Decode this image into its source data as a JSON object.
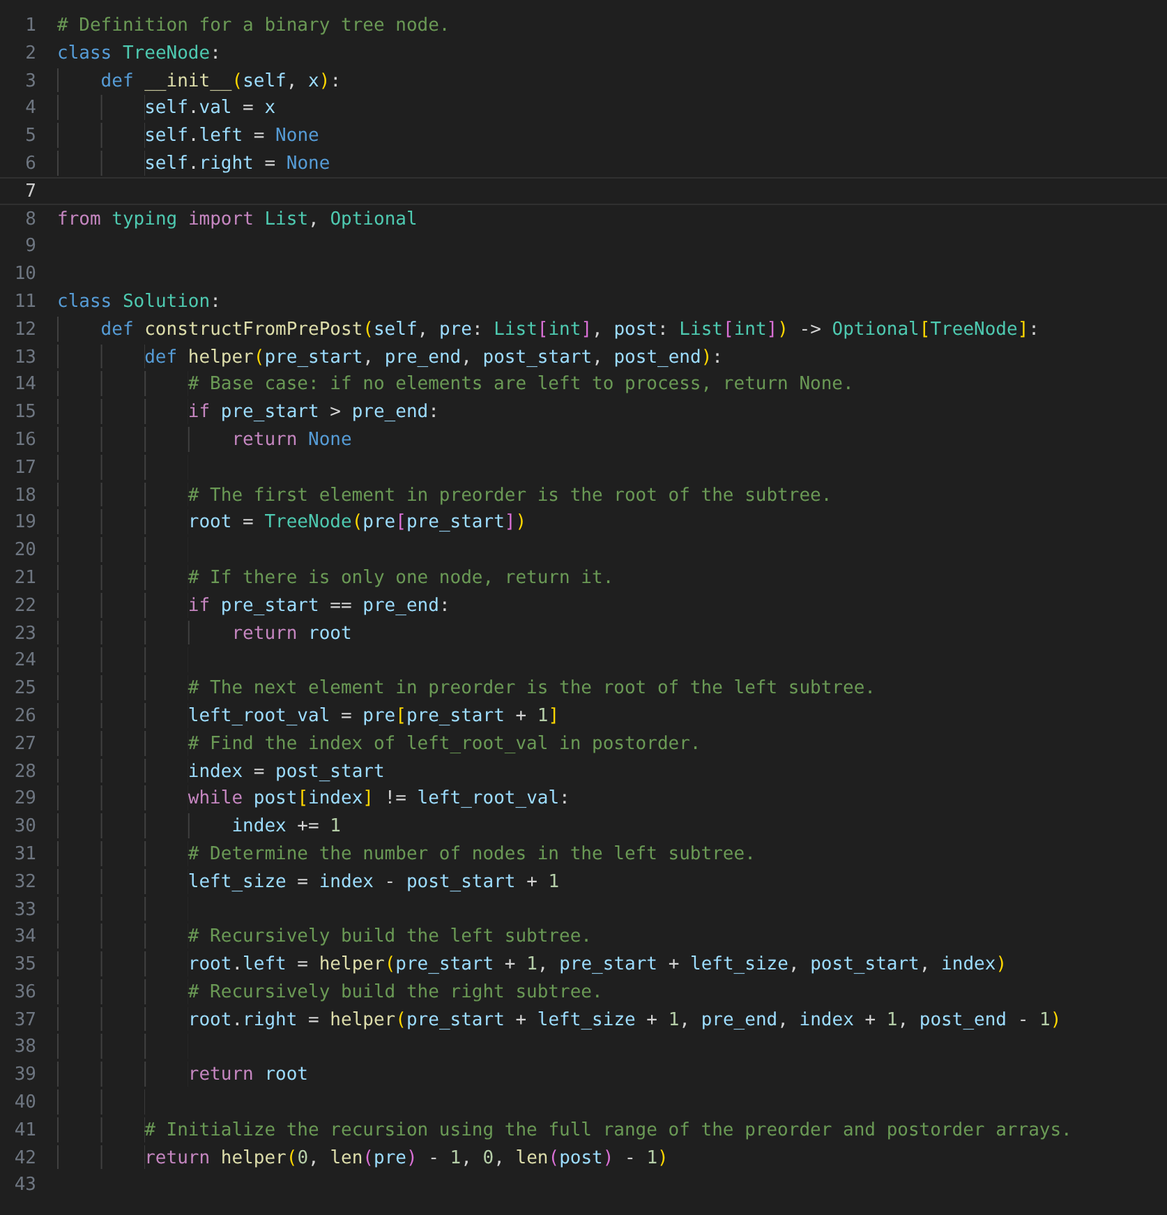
{
  "editor": {
    "lines": [
      {
        "number": "1",
        "current": false,
        "tokens": [
          {
            "text": "# Definition for a binary tree node.",
            "kind": "comment"
          }
        ]
      },
      {
        "number": "2",
        "current": false,
        "tokens": [
          {
            "text": "class ",
            "kind": "keyword"
          },
          {
            "text": "TreeNode",
            "kind": "class"
          },
          {
            "text": ":",
            "kind": "op"
          }
        ],
        "children": [
          {
            "number": "3",
            "current": false,
            "tokens": [
              {
                "text": "def ",
                "kind": "keyword"
              },
              {
                "text": "__init__",
                "kind": "function"
              },
              {
                "text": "(",
                "kind": "bracket1"
              },
              {
                "text": "self",
                "kind": "variable"
              },
              {
                "text": ", ",
                "kind": "op"
              },
              {
                "text": "x",
                "kind": "variable"
              },
              {
                "text": ")",
                "kind": "bracket1"
              },
              {
                "text": ":",
                "kind": "op"
              }
            ],
            "children": [
              {
                "number": "4",
                "current": false,
                "tokens": [
                  {
                    "text": "self",
                    "kind": "variable"
                  },
                  {
                    "text": ".",
                    "kind": "op"
                  },
                  {
                    "text": "val",
                    "kind": "variable"
                  },
                  {
                    "text": " = ",
                    "kind": "op"
                  },
                  {
                    "text": "x",
                    "kind": "variable"
                  }
                ]
              },
              {
                "number": "5",
                "current": false,
                "tokens": [
                  {
                    "text": "self",
                    "kind": "variable"
                  },
                  {
                    "text": ".",
                    "kind": "op"
                  },
                  {
                    "text": "left",
                    "kind": "variable"
                  },
                  {
                    "text": " = ",
                    "kind": "op"
                  },
                  {
                    "text": "None",
                    "kind": "constant"
                  }
                ]
              },
              {
                "number": "6",
                "current": false,
                "tokens": [
                  {
                    "text": "self",
                    "kind": "variable"
                  },
                  {
                    "text": ".",
                    "kind": "op"
                  },
                  {
                    "text": "right",
                    "kind": "variable"
                  },
                  {
                    "text": " = ",
                    "kind": "op"
                  },
                  {
                    "text": "None",
                    "kind": "constant"
                  }
                ]
              }
            ]
          }
        ]
      },
      {
        "number": "7",
        "current": true
      },
      {
        "number": "8",
        "current": false,
        "tokens": [
          {
            "text": "from ",
            "kind": "control"
          },
          {
            "text": "typing ",
            "kind": "class"
          },
          {
            "text": "import ",
            "kind": "control"
          },
          {
            "text": "List",
            "kind": "class"
          },
          {
            "text": ", ",
            "kind": "op"
          },
          {
            "text": "Optional",
            "kind": "class"
          }
        ]
      },
      {
        "number": "9",
        "current": false
      },
      {
        "number": "10",
        "current": false
      },
      {
        "number": "11",
        "current": false,
        "tokens": [
          {
            "text": "class ",
            "kind": "keyword"
          },
          {
            "text": "Solution",
            "kind": "class"
          },
          {
            "text": ":",
            "kind": "op"
          }
        ],
        "children": [
          {
            "number": "12",
            "current": false,
            "tokens": [
              {
                "text": "def ",
                "kind": "keyword"
              },
              {
                "text": "constructFromPrePost",
                "kind": "function"
              },
              {
                "text": "(",
                "kind": "bracket1"
              },
              {
                "text": "self",
                "kind": "variable"
              },
              {
                "text": ", ",
                "kind": "op"
              },
              {
                "text": "pre",
                "kind": "variable"
              },
              {
                "text": ": ",
                "kind": "op"
              },
              {
                "text": "List",
                "kind": "class"
              },
              {
                "text": "[",
                "kind": "bracket2"
              },
              {
                "text": "int",
                "kind": "class"
              },
              {
                "text": "]",
                "kind": "bracket2"
              },
              {
                "text": ", ",
                "kind": "op"
              },
              {
                "text": "post",
                "kind": "variable"
              },
              {
                "text": ": ",
                "kind": "op"
              },
              {
                "text": "List",
                "kind": "class"
              },
              {
                "text": "[",
                "kind": "bracket2"
              },
              {
                "text": "int",
                "kind": "class"
              },
              {
                "text": "]",
                "kind": "bracket2"
              },
              {
                "text": ")",
                "kind": "bracket1"
              },
              {
                "text": " -> ",
                "kind": "op"
              },
              {
                "text": "Optional",
                "kind": "class"
              },
              {
                "text": "[",
                "kind": "bracket1"
              },
              {
                "text": "TreeNode",
                "kind": "class"
              },
              {
                "text": "]",
                "kind": "bracket1"
              },
              {
                "text": ":",
                "kind": "op"
              }
            ],
            "children": [
              {
                "number": "13",
                "current": false,
                "tokens": [
                  {
                    "text": "def ",
                    "kind": "keyword"
                  },
                  {
                    "text": "helper",
                    "kind": "function"
                  },
                  {
                    "text": "(",
                    "kind": "bracket1"
                  },
                  {
                    "text": "pre_start",
                    "kind": "variable"
                  },
                  {
                    "text": ", ",
                    "kind": "op"
                  },
                  {
                    "text": "pre_end",
                    "kind": "variable"
                  },
                  {
                    "text": ", ",
                    "kind": "op"
                  },
                  {
                    "text": "post_start",
                    "kind": "variable"
                  },
                  {
                    "text": ", ",
                    "kind": "op"
                  },
                  {
                    "text": "post_end",
                    "kind": "variable"
                  },
                  {
                    "text": ")",
                    "kind": "bracket1"
                  },
                  {
                    "text": ":",
                    "kind": "op"
                  }
                ],
                "children": [
                  {
                    "number": "14",
                    "current": false,
                    "tokens": [
                      {
                        "text": "# Base case: if no elements are left to process, return None.",
                        "kind": "comment"
                      }
                    ]
                  },
                  {
                    "number": "15",
                    "current": false,
                    "tokens": [
                      {
                        "text": "if ",
                        "kind": "control"
                      },
                      {
                        "text": "pre_start",
                        "kind": "variable"
                      },
                      {
                        "text": " > ",
                        "kind": "op"
                      },
                      {
                        "text": "pre_end",
                        "kind": "variable"
                      },
                      {
                        "text": ":",
                        "kind": "op"
                      }
                    ],
                    "children": [
                      {
                        "number": "16",
                        "current": false,
                        "tokens": [
                          {
                            "text": "return ",
                            "kind": "control"
                          },
                          {
                            "text": "None",
                            "kind": "constant"
                          }
                        ]
                      }
                    ]
                  },
                  {
                    "number": "17",
                    "current": false
                  },
                  {
                    "number": "18",
                    "current": false,
                    "tokens": [
                      {
                        "text": "# The first element in preorder is the root of the subtree.",
                        "kind": "comment"
                      }
                    ]
                  },
                  {
                    "number": "19",
                    "current": false,
                    "tokens": [
                      {
                        "text": "root",
                        "kind": "variable"
                      },
                      {
                        "text": " = ",
                        "kind": "op"
                      },
                      {
                        "text": "TreeNode",
                        "kind": "class"
                      },
                      {
                        "text": "(",
                        "kind": "bracket1"
                      },
                      {
                        "text": "pre",
                        "kind": "variable"
                      },
                      {
                        "text": "[",
                        "kind": "bracket2"
                      },
                      {
                        "text": "pre_start",
                        "kind": "variable"
                      },
                      {
                        "text": "]",
                        "kind": "bracket2"
                      },
                      {
                        "text": ")",
                        "kind": "bracket1"
                      }
                    ]
                  },
                  {
                    "number": "20",
                    "current": false
                  },
                  {
                    "number": "21",
                    "current": false,
                    "tokens": [
                      {
                        "text": "# If there is only one node, return it.",
                        "kind": "comment"
                      }
                    ]
                  },
                  {
                    "number": "22",
                    "current": false,
                    "tokens": [
                      {
                        "text": "if ",
                        "kind": "control"
                      },
                      {
                        "text": "pre_start",
                        "kind": "variable"
                      },
                      {
                        "text": " == ",
                        "kind": "op"
                      },
                      {
                        "text": "pre_end",
                        "kind": "variable"
                      },
                      {
                        "text": ":",
                        "kind": "op"
                      }
                    ],
                    "children": [
                      {
                        "number": "23",
                        "current": false,
                        "tokens": [
                          {
                            "text": "return ",
                            "kind": "control"
                          },
                          {
                            "text": "root",
                            "kind": "variable"
                          }
                        ]
                      }
                    ]
                  },
                  {
                    "number": "24",
                    "current": false
                  },
                  {
                    "number": "25",
                    "current": false,
                    "tokens": [
                      {
                        "text": "# The next element in preorder is the root of the left subtree.",
                        "kind": "comment"
                      }
                    ]
                  },
                  {
                    "number": "26",
                    "current": false,
                    "tokens": [
                      {
                        "text": "left_root_val",
                        "kind": "variable"
                      },
                      {
                        "text": " = ",
                        "kind": "op"
                      },
                      {
                        "text": "pre",
                        "kind": "variable"
                      },
                      {
                        "text": "[",
                        "kind": "bracket1"
                      },
                      {
                        "text": "pre_start",
                        "kind": "variable"
                      },
                      {
                        "text": " + ",
                        "kind": "op"
                      },
                      {
                        "text": "1",
                        "kind": "number"
                      },
                      {
                        "text": "]",
                        "kind": "bracket1"
                      }
                    ]
                  },
                  {
                    "number": "27",
                    "current": false,
                    "tokens": [
                      {
                        "text": "# Find the index of left_root_val in postorder.",
                        "kind": "comment"
                      }
                    ]
                  },
                  {
                    "number": "28",
                    "current": false,
                    "tokens": [
                      {
                        "text": "index",
                        "kind": "variable"
                      },
                      {
                        "text": " = ",
                        "kind": "op"
                      },
                      {
                        "text": "post_start",
                        "kind": "variable"
                      }
                    ]
                  },
                  {
                    "number": "29",
                    "current": false,
                    "tokens": [
                      {
                        "text": "while ",
                        "kind": "control"
                      },
                      {
                        "text": "post",
                        "kind": "variable"
                      },
                      {
                        "text": "[",
                        "kind": "bracket1"
                      },
                      {
                        "text": "index",
                        "kind": "variable"
                      },
                      {
                        "text": "]",
                        "kind": "bracket1"
                      },
                      {
                        "text": " != ",
                        "kind": "op"
                      },
                      {
                        "text": "left_root_val",
                        "kind": "variable"
                      },
                      {
                        "text": ":",
                        "kind": "op"
                      }
                    ],
                    "children": [
                      {
                        "number": "30",
                        "current": false,
                        "tokens": [
                          {
                            "text": "index",
                            "kind": "variable"
                          },
                          {
                            "text": " += ",
                            "kind": "op"
                          },
                          {
                            "text": "1",
                            "kind": "number"
                          }
                        ]
                      }
                    ]
                  },
                  {
                    "number": "31",
                    "current": false,
                    "tokens": [
                      {
                        "text": "# Determine the number of nodes in the left subtree.",
                        "kind": "comment"
                      }
                    ]
                  },
                  {
                    "number": "32",
                    "current": false,
                    "tokens": [
                      {
                        "text": "left_size",
                        "kind": "variable"
                      },
                      {
                        "text": " = ",
                        "kind": "op"
                      },
                      {
                        "text": "index",
                        "kind": "variable"
                      },
                      {
                        "text": " - ",
                        "kind": "op"
                      },
                      {
                        "text": "post_start",
                        "kind": "variable"
                      },
                      {
                        "text": " + ",
                        "kind": "op"
                      },
                      {
                        "text": "1",
                        "kind": "number"
                      }
                    ]
                  },
                  {
                    "number": "33",
                    "current": false
                  },
                  {
                    "number": "34",
                    "current": false,
                    "tokens": [
                      {
                        "text": "# Recursively build the left subtree.",
                        "kind": "comment"
                      }
                    ]
                  },
                  {
                    "number": "35",
                    "current": false,
                    "tokens": [
                      {
                        "text": "root",
                        "kind": "variable"
                      },
                      {
                        "text": ".",
                        "kind": "op"
                      },
                      {
                        "text": "left",
                        "kind": "variable"
                      },
                      {
                        "text": " = ",
                        "kind": "op"
                      },
                      {
                        "text": "helper",
                        "kind": "function"
                      },
                      {
                        "text": "(",
                        "kind": "bracket1"
                      },
                      {
                        "text": "pre_start",
                        "kind": "variable"
                      },
                      {
                        "text": " + ",
                        "kind": "op"
                      },
                      {
                        "text": "1",
                        "kind": "number"
                      },
                      {
                        "text": ", ",
                        "kind": "op"
                      },
                      {
                        "text": "pre_start",
                        "kind": "variable"
                      },
                      {
                        "text": " + ",
                        "kind": "op"
                      },
                      {
                        "text": "left_size",
                        "kind": "variable"
                      },
                      {
                        "text": ", ",
                        "kind": "op"
                      },
                      {
                        "text": "post_start",
                        "kind": "variable"
                      },
                      {
                        "text": ", ",
                        "kind": "op"
                      },
                      {
                        "text": "index",
                        "kind": "variable"
                      },
                      {
                        "text": ")",
                        "kind": "bracket1"
                      }
                    ]
                  },
                  {
                    "number": "36",
                    "current": false,
                    "tokens": [
                      {
                        "text": "# Recursively build the right subtree.",
                        "kind": "comment"
                      }
                    ]
                  },
                  {
                    "number": "37",
                    "current": false,
                    "tokens": [
                      {
                        "text": "root",
                        "kind": "variable"
                      },
                      {
                        "text": ".",
                        "kind": "op"
                      },
                      {
                        "text": "right",
                        "kind": "variable"
                      },
                      {
                        "text": " = ",
                        "kind": "op"
                      },
                      {
                        "text": "helper",
                        "kind": "function"
                      },
                      {
                        "text": "(",
                        "kind": "bracket1"
                      },
                      {
                        "text": "pre_start",
                        "kind": "variable"
                      },
                      {
                        "text": " + ",
                        "kind": "op"
                      },
                      {
                        "text": "left_size",
                        "kind": "variable"
                      },
                      {
                        "text": " + ",
                        "kind": "op"
                      },
                      {
                        "text": "1",
                        "kind": "number"
                      },
                      {
                        "text": ", ",
                        "kind": "op"
                      },
                      {
                        "text": "pre_end",
                        "kind": "variable"
                      },
                      {
                        "text": ", ",
                        "kind": "op"
                      },
                      {
                        "text": "index",
                        "kind": "variable"
                      },
                      {
                        "text": " + ",
                        "kind": "op"
                      },
                      {
                        "text": "1",
                        "kind": "number"
                      },
                      {
                        "text": ", ",
                        "kind": "op"
                      },
                      {
                        "text": "post_end",
                        "kind": "variable"
                      },
                      {
                        "text": " - ",
                        "kind": "op"
                      },
                      {
                        "text": "1",
                        "kind": "number"
                      },
                      {
                        "text": ")",
                        "kind": "bracket1"
                      }
                    ]
                  },
                  {
                    "number": "38",
                    "current": false
                  },
                  {
                    "number": "39",
                    "current": false,
                    "tokens": [
                      {
                        "text": "return ",
                        "kind": "control"
                      },
                      {
                        "text": "root",
                        "kind": "variable"
                      }
                    ]
                  }
                ]
              },
              {
                "number": "40",
                "current": false
              },
              {
                "number": "41",
                "current": false,
                "tokens": [
                  {
                    "text": "# Initialize the recursion using the full range of the preorder and postorder arrays.",
                    "kind": "comment"
                  }
                ]
              },
              {
                "number": "42",
                "current": false,
                "tokens": [
                  {
                    "text": "return ",
                    "kind": "control"
                  },
                  {
                    "text": "helper",
                    "kind": "function"
                  },
                  {
                    "text": "(",
                    "kind": "bracket1"
                  },
                  {
                    "text": "0",
                    "kind": "number"
                  },
                  {
                    "text": ", ",
                    "kind": "op"
                  },
                  {
                    "text": "len",
                    "kind": "function"
                  },
                  {
                    "text": "(",
                    "kind": "bracket2"
                  },
                  {
                    "text": "pre",
                    "kind": "variable"
                  },
                  {
                    "text": ")",
                    "kind": "bracket2"
                  },
                  {
                    "text": " - ",
                    "kind": "op"
                  },
                  {
                    "text": "1",
                    "kind": "number"
                  },
                  {
                    "text": ", ",
                    "kind": "op"
                  },
                  {
                    "text": "0",
                    "kind": "number"
                  },
                  {
                    "text": ", ",
                    "kind": "op"
                  },
                  {
                    "text": "len",
                    "kind": "function"
                  },
                  {
                    "text": "(",
                    "kind": "bracket2"
                  },
                  {
                    "text": "post",
                    "kind": "variable"
                  },
                  {
                    "text": ")",
                    "kind": "bracket2"
                  },
                  {
                    "text": " - ",
                    "kind": "op"
                  },
                  {
                    "text": "1",
                    "kind": "number"
                  },
                  {
                    "text": ")",
                    "kind": "bracket1"
                  }
                ]
              }
            ]
          }
        ]
      },
      {
        "number": "43",
        "current": false
      }
    ]
  }
}
